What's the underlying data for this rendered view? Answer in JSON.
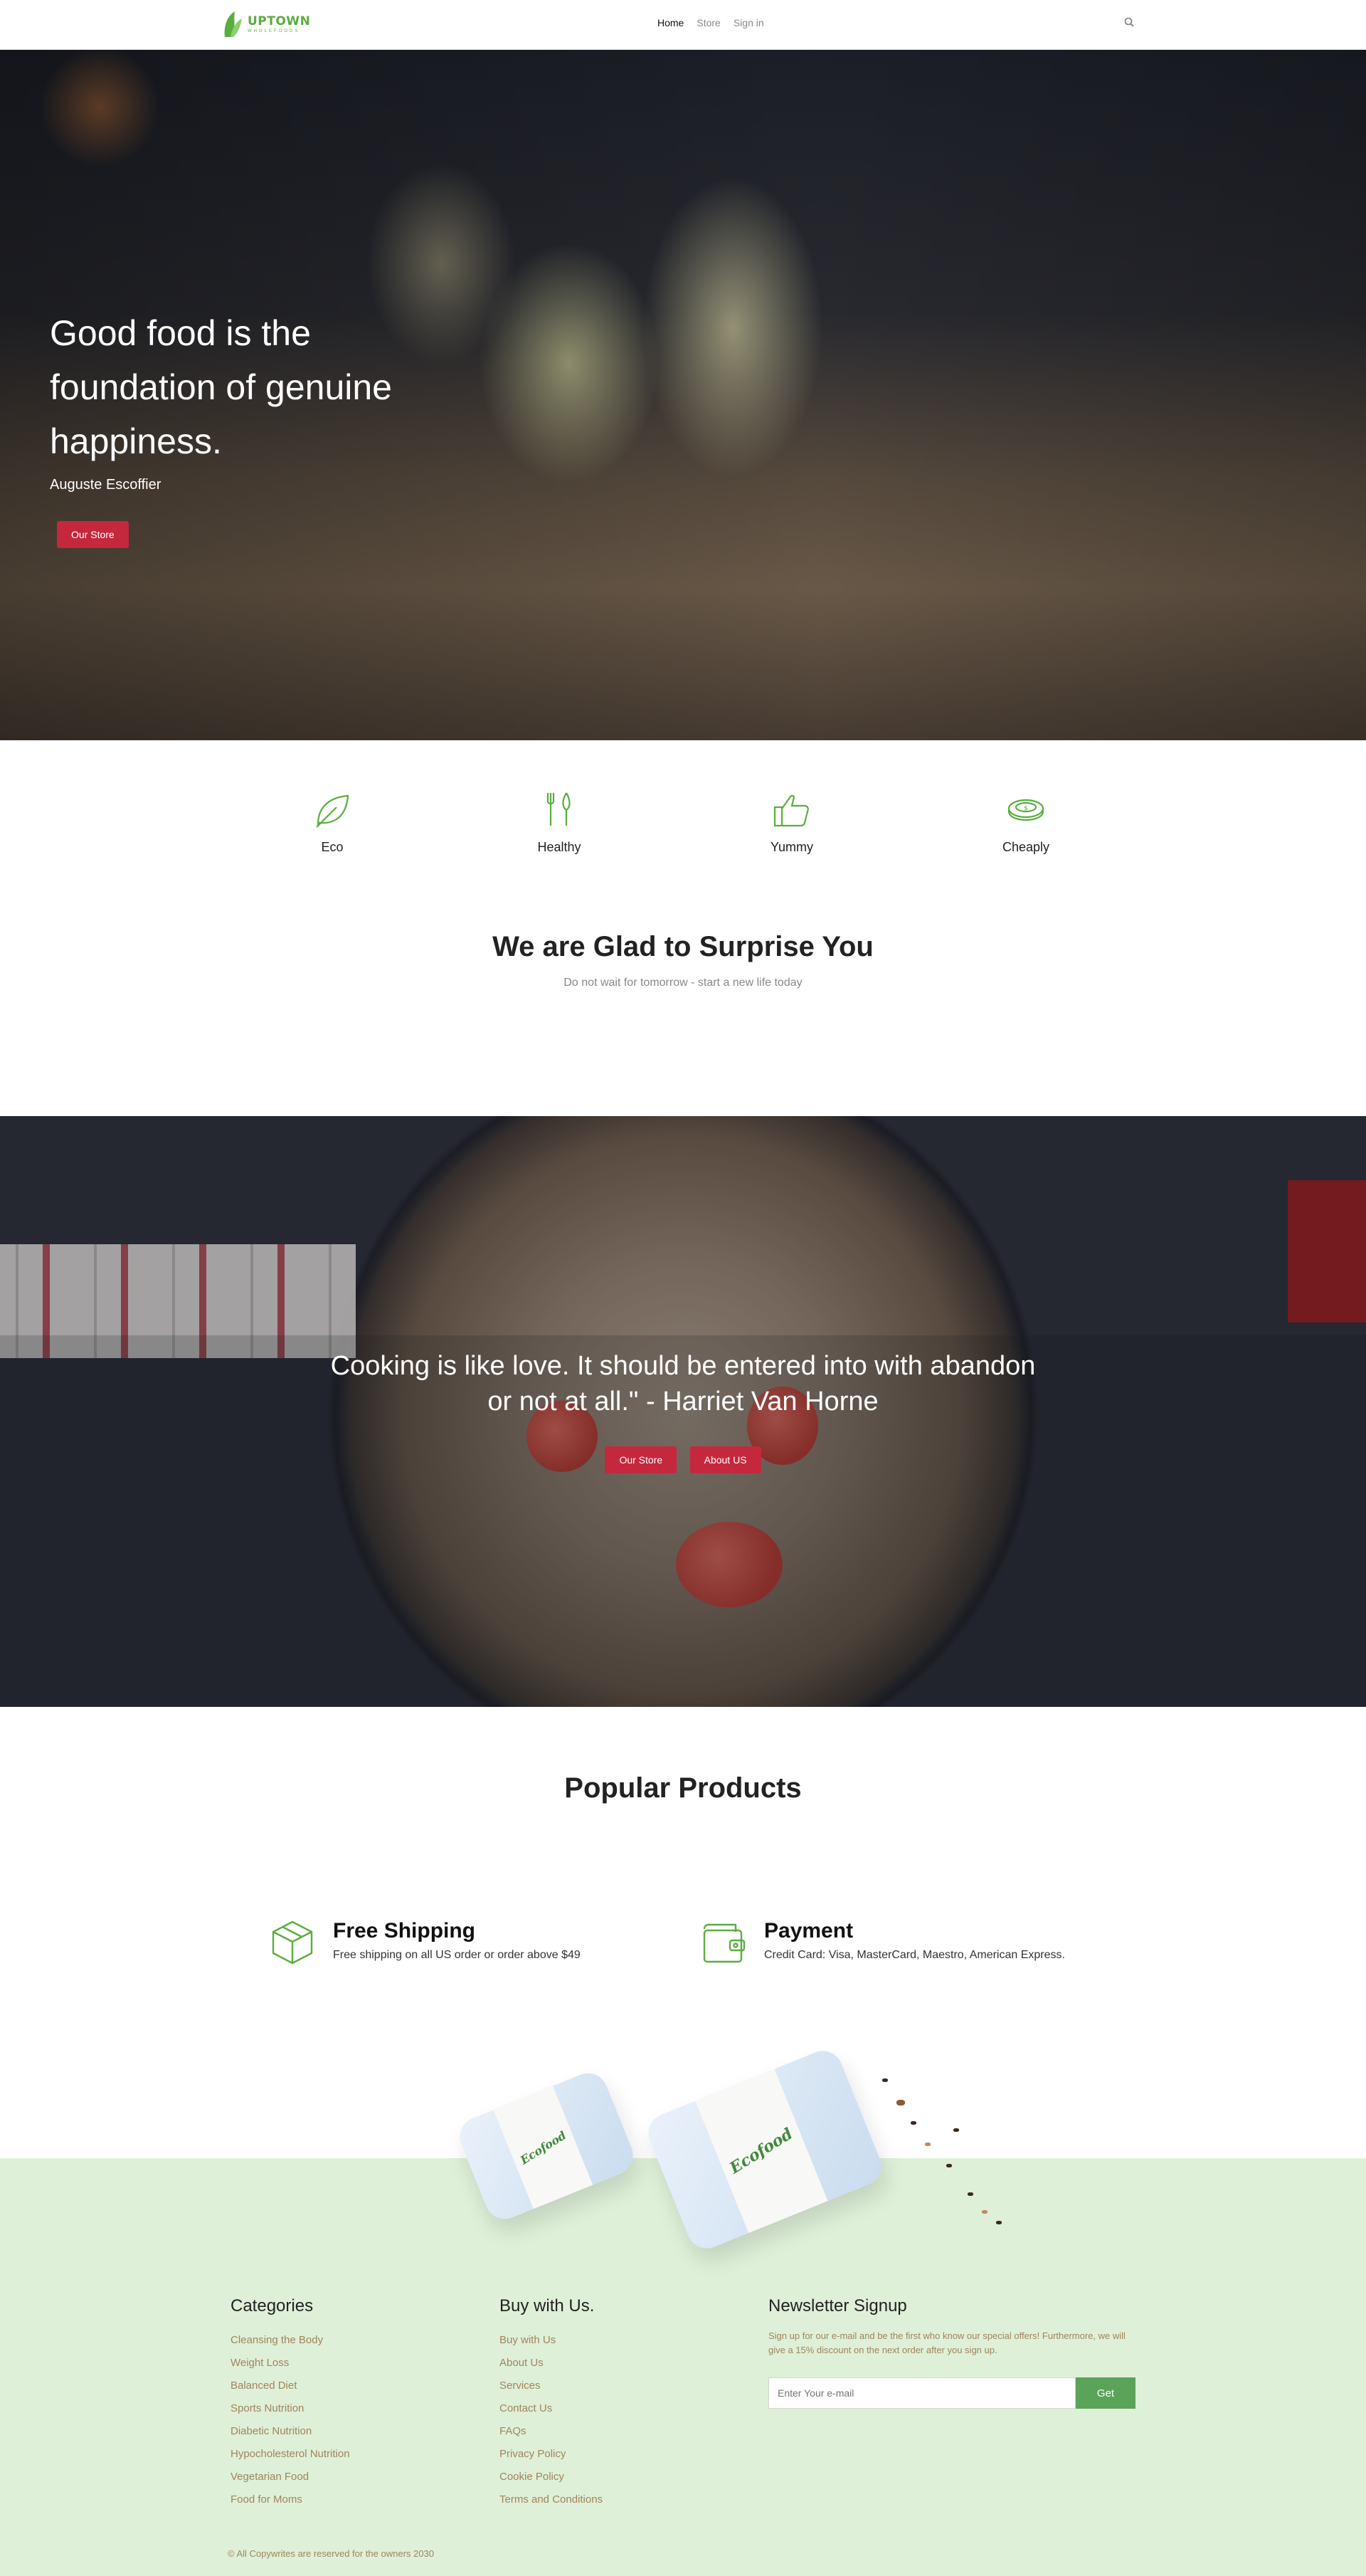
{
  "header": {
    "logo_name": "UPTOWN",
    "logo_sub": "WHOLEFOODS",
    "nav": [
      "Home",
      "Store",
      "Sign in"
    ]
  },
  "hero": {
    "title": "Good food is the foundation of genuine happiness.",
    "author": "Auguste Escoffier",
    "button": "Our Store"
  },
  "features": [
    {
      "label": "Eco",
      "icon": "leaf-icon"
    },
    {
      "label": "Healthy",
      "icon": "fork-knife-icon"
    },
    {
      "label": "Yummy",
      "icon": "thumbs-up-icon"
    },
    {
      "label": "Cheaply",
      "icon": "coins-icon"
    }
  ],
  "surprise": {
    "title": "We are Glad to Surprise You",
    "subtitle": "Do not wait for tomorrow - start a new life today"
  },
  "quote": {
    "text": "Cooking is like love. It should be entered into with abandon or not at all.\" - Harriet Van Horne",
    "button_store": "Our Store",
    "button_about": "About US"
  },
  "popular": {
    "title": "Popular Products"
  },
  "info": {
    "shipping_title": "Free Shipping",
    "shipping_text": "Free shipping on all US order or order above $49",
    "payment_title": "Payment",
    "payment_text": "Credit Card: Visa, MasterCard, Maestro, American Express."
  },
  "product_label": "Ecofood",
  "footer": {
    "categories_title": "Categories",
    "categories": [
      "Cleansing the Body",
      "Weight Loss",
      "Balanced Diet",
      "Sports Nutrition",
      "Diabetic Nutrition",
      "Hypocholesterol Nutrition",
      "Vegetarian Food",
      "Food for Moms"
    ],
    "buy_title": "Buy with Us.",
    "buy": [
      "Buy with Us",
      "About Us",
      "Services",
      "Contact Us",
      "FAQs",
      "Privacy Policy",
      "Cookie Policy",
      "Terms and Conditions"
    ],
    "newsletter_title": "Newsletter Signup",
    "newsletter_text": "Sign up for our e-mail and be the first who know our special offers! Furthermore, we will give a 15% discount on the next order after you sign up.",
    "newsletter_placeholder": "Enter Your e-mail",
    "newsletter_button": "Get",
    "copyright": "© All Copywrites are reserved for the owners 2030"
  },
  "colors": {
    "accent_red": "#c5283d",
    "brand_green": "#5aad3f",
    "footer_bg": "#def0d8",
    "footer_link": "#a0845c"
  }
}
